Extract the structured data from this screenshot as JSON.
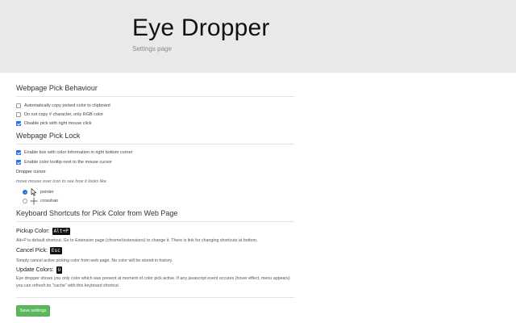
{
  "header": {
    "title": "Eye Dropper",
    "subtitle": "Settings page"
  },
  "webpage_pick_behaviour": {
    "title": "Webpage Pick Behaviour",
    "options": [
      {
        "label": "Automatically copy picked color to clipboard",
        "checked": false
      },
      {
        "label": "Do not copy # character, only RGB color",
        "checked": false
      },
      {
        "label": "Disable pick with right mouse click",
        "checked": true
      }
    ]
  },
  "webpage_pick_lock": {
    "title": "Webpage Pick Lock",
    "options": [
      {
        "label": "Enable box with color information in right bottom corner",
        "checked": true
      },
      {
        "label": "Enable color tooltip next to the mouse cursor",
        "checked": true
      }
    ],
    "dropper_cursor_label": "Dropper cursor",
    "dropper_cursor_hint": "move mouse over icon to see how it looks like",
    "cursor_choices": [
      {
        "label": "pointer",
        "selected": true,
        "icon": "pointer-cursor-icon"
      },
      {
        "label": "crosshair",
        "selected": false,
        "icon": "crosshair-cursor-icon"
      }
    ]
  },
  "keyboard_shortcuts": {
    "title": "Keyboard Shortcuts for Pick Color from Web Page",
    "pickup": {
      "label": "Pickup Color:",
      "key": "Alt+P",
      "description": "Alt+P is default shortcut. Go to Extension page (chrome//extensions) to change it. There is link for changing shortcuts at bottom."
    },
    "cancel": {
      "label": "Cancel Pick:",
      "key": "Esc",
      "description": "Simply cancel active picking color from web page. No color will be stored in history."
    },
    "update": {
      "label": "Update Colors:",
      "key": "U",
      "description": "Eye dropper shows you only color which was present at moment of color pick active. If any javascript event occures (hover effect, menu appears) you can refresh its \"cache\" with this keyboard shortcut."
    }
  },
  "save_button_label": "Save settings",
  "colors": {
    "header_bg": "#e9e9e9",
    "checkbox_accent": "#2d6fe0",
    "save_button": "#5cb85c"
  }
}
